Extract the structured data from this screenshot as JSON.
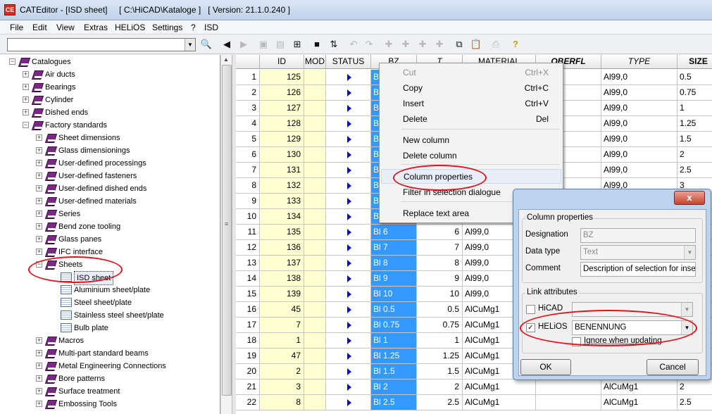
{
  "window": {
    "title": "CATEditor - [ISD sheet]     [ C:\\HiCAD\\Kataloge ]   [ Version: 21.1.0.240 ]"
  },
  "menu": [
    "File",
    "Edit",
    "View",
    "Extras",
    "HELiOS",
    "Settings",
    "?",
    "ISD"
  ],
  "tree": [
    {
      "label": "Catalogues",
      "depth": 0,
      "exp": "-",
      "icon": "book-icon"
    },
    {
      "label": "Air ducts",
      "depth": 1,
      "exp": "+",
      "icon": "book-icon"
    },
    {
      "label": "Bearings",
      "depth": 1,
      "exp": "+",
      "icon": "book-icon"
    },
    {
      "label": "Cylinder",
      "depth": 1,
      "exp": "+",
      "icon": "book-icon"
    },
    {
      "label": "Dished ends",
      "depth": 1,
      "exp": "+",
      "icon": "book-icon"
    },
    {
      "label": "Factory standards",
      "depth": 1,
      "exp": "-",
      "icon": "book-icon"
    },
    {
      "label": "Sheet dimensions",
      "depth": 2,
      "exp": "+",
      "icon": "book-icon"
    },
    {
      "label": "Glass dimensionings",
      "depth": 2,
      "exp": "+",
      "icon": "book-icon"
    },
    {
      "label": "User-defined processings",
      "depth": 2,
      "exp": "+",
      "icon": "book-icon"
    },
    {
      "label": "User-defined fasteners",
      "depth": 2,
      "exp": "+",
      "icon": "book-icon"
    },
    {
      "label": "User-defined dished ends",
      "depth": 2,
      "exp": "+",
      "icon": "book-icon"
    },
    {
      "label": "User-defined materials",
      "depth": 2,
      "exp": "+",
      "icon": "book-icon"
    },
    {
      "label": "Series",
      "depth": 2,
      "exp": "+",
      "icon": "book-icon"
    },
    {
      "label": "Bend zone tooling",
      "depth": 2,
      "exp": "+",
      "icon": "book-icon"
    },
    {
      "label": "Glass panes",
      "depth": 2,
      "exp": "+",
      "icon": "book-icon"
    },
    {
      "label": "IFC interface",
      "depth": 2,
      "exp": "+",
      "icon": "book-icon"
    },
    {
      "label": "Sheets",
      "depth": 2,
      "exp": "-",
      "icon": "book-icon"
    },
    {
      "label": "ISD sheet",
      "depth": 3,
      "exp": "",
      "icon": "sheet-icon",
      "selected": true
    },
    {
      "label": "Aluminium sheet/plate",
      "depth": 3,
      "exp": "",
      "icon": "sheet-icon"
    },
    {
      "label": "Steel sheet/plate",
      "depth": 3,
      "exp": "",
      "icon": "sheet-icon"
    },
    {
      "label": "Stainless steel sheet/plate",
      "depth": 3,
      "exp": "",
      "icon": "sheet-icon"
    },
    {
      "label": "Bulb plate",
      "depth": 3,
      "exp": "",
      "icon": "sheet-icon"
    },
    {
      "label": "Macros",
      "depth": 2,
      "exp": "+",
      "icon": "book-icon"
    },
    {
      "label": "Multi-part standard beams",
      "depth": 2,
      "exp": "+",
      "icon": "book-icon"
    },
    {
      "label": "Metal Engineering Connections",
      "depth": 2,
      "exp": "+",
      "icon": "book-icon"
    },
    {
      "label": "Bore patterns",
      "depth": 2,
      "exp": "+",
      "icon": "book-icon"
    },
    {
      "label": "Surface treatment",
      "depth": 2,
      "exp": "+",
      "icon": "book-icon"
    },
    {
      "label": "Embossing Tools",
      "depth": 2,
      "exp": "+",
      "icon": "book-icon"
    }
  ],
  "grid": {
    "columns": [
      "ID",
      "MOD",
      "STATUS",
      "BZ",
      "T",
      "MATERIAL",
      "OBERFL",
      "TYPE",
      "SIZE"
    ],
    "rows": [
      {
        "n": "1",
        "id": "125",
        "bz": "B",
        "t": "",
        "mat": "",
        "type": "Al99,0",
        "size": "0.5"
      },
      {
        "n": "2",
        "id": "126",
        "bz": "B",
        "t": "",
        "mat": "",
        "type": "Al99,0",
        "size": "0.75"
      },
      {
        "n": "3",
        "id": "127",
        "bz": "B",
        "t": "",
        "mat": "",
        "type": "Al99,0",
        "size": "1"
      },
      {
        "n": "4",
        "id": "128",
        "bz": "B",
        "t": "",
        "mat": "",
        "type": "Al99,0",
        "size": "1.25"
      },
      {
        "n": "5",
        "id": "129",
        "bz": "B",
        "t": "",
        "mat": "",
        "type": "Al99,0",
        "size": "1.5"
      },
      {
        "n": "6",
        "id": "130",
        "bz": "B",
        "t": "",
        "mat": "",
        "type": "Al99,0",
        "size": "2"
      },
      {
        "n": "7",
        "id": "131",
        "bz": "B",
        "t": "",
        "mat": "",
        "type": "Al99,0",
        "size": "2.5"
      },
      {
        "n": "8",
        "id": "132",
        "bz": "B",
        "t": "",
        "mat": "",
        "type": "Al99,0",
        "size": "3"
      },
      {
        "n": "9",
        "id": "133",
        "bz": "B",
        "t": "",
        "mat": "",
        "type": "",
        "size": ""
      },
      {
        "n": "10",
        "id": "134",
        "bz": "B",
        "t": "",
        "mat": "",
        "type": "",
        "size": ""
      },
      {
        "n": "11",
        "id": "135",
        "bz": "Bl 6",
        "t": "6",
        "mat": "Al99,0",
        "type": "",
        "size": ""
      },
      {
        "n": "12",
        "id": "136",
        "bz": "Bl 7",
        "t": "7",
        "mat": "Al99,0",
        "type": "",
        "size": ""
      },
      {
        "n": "13",
        "id": "137",
        "bz": "Bl 8",
        "t": "8",
        "mat": "Al99,0",
        "type": "",
        "size": ""
      },
      {
        "n": "14",
        "id": "138",
        "bz": "Bl 9",
        "t": "9",
        "mat": "Al99,0",
        "type": "",
        "size": ""
      },
      {
        "n": "15",
        "id": "139",
        "bz": "Bl 10",
        "t": "10",
        "mat": "Al99,0",
        "type": "",
        "size": ""
      },
      {
        "n": "16",
        "id": "45",
        "bz": "Bl 0.5",
        "t": "0.5",
        "mat": "AlCuMg1",
        "type": "",
        "size": ""
      },
      {
        "n": "17",
        "id": "7",
        "bz": "Bl 0.75",
        "t": "0.75",
        "mat": "AlCuMg1",
        "type": "",
        "size": ""
      },
      {
        "n": "18",
        "id": "1",
        "bz": "Bl 1",
        "t": "1",
        "mat": "AlCuMg1",
        "type": "",
        "size": ""
      },
      {
        "n": "19",
        "id": "47",
        "bz": "Bl 1.25",
        "t": "1.25",
        "mat": "AlCuMg1",
        "type": "",
        "size": ""
      },
      {
        "n": "20",
        "id": "2",
        "bz": "Bl 1.5",
        "t": "1.5",
        "mat": "AlCuMg1",
        "type": "",
        "size": ""
      },
      {
        "n": "21",
        "id": "3",
        "bz": "Bl 2",
        "t": "2",
        "mat": "AlCuMg1",
        "type": "AlCuMg1",
        "size": "2"
      },
      {
        "n": "22",
        "id": "8",
        "bz": "Bl 2.5",
        "t": "2.5",
        "mat": "AlCuMg1",
        "type": "AlCuMg1",
        "size": "2.5"
      }
    ]
  },
  "context_menu": {
    "items": [
      {
        "label": "Cut",
        "shortcut": "Ctrl+X",
        "disabled": true
      },
      {
        "label": "Copy",
        "shortcut": "Ctrl+C"
      },
      {
        "label": "Insert",
        "shortcut": "Ctrl+V"
      },
      {
        "label": "Delete",
        "shortcut": "Del"
      },
      {
        "label": "New column",
        "shortcut": ""
      },
      {
        "label": "Delete column",
        "shortcut": ""
      },
      {
        "label": "Column properties",
        "shortcut": "",
        "highlighted": true
      },
      {
        "label": "Filter in selection dialogue",
        "shortcut": ""
      },
      {
        "label": "Replace text area",
        "shortcut": ""
      }
    ]
  },
  "dialog": {
    "close": "x",
    "column_properties": {
      "legend": "Column properties",
      "designation_label": "Designation",
      "designation_value": "BZ",
      "data_type_label": "Data type",
      "data_type_value": "Text",
      "comment_label": "Comment",
      "comment_value": "Description of selection for insert"
    },
    "link_attributes": {
      "legend": "Link attributes",
      "hicad_label": "HiCAD",
      "hicad_checked": false,
      "helios_label": "HELiOS",
      "helios_checked": true,
      "helios_value": "BENENNUNG",
      "ignore_label": "Ignore when updating",
      "ignore_checked": false
    },
    "ok_label": "OK",
    "cancel_label": "Cancel"
  },
  "highlight_color": "#e0141b",
  "selection_color": "#3399ff"
}
